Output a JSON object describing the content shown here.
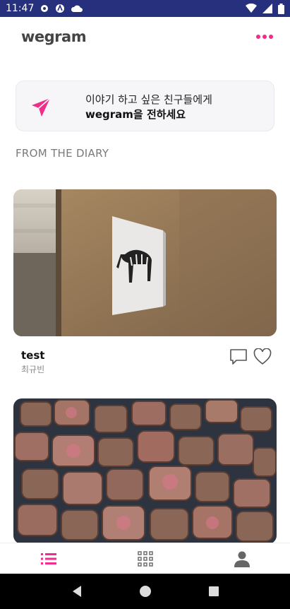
{
  "status_bar": {
    "time": "11:47",
    "icons_left": [
      "gear-icon",
      "a-icon",
      "cloud-icon"
    ],
    "icons_right": [
      "wifi-icon",
      "signal-icon",
      "battery-icon"
    ]
  },
  "app": {
    "logo": "wegram",
    "menu_icon": "more-dots-icon",
    "accent_color": "#ef2d8b"
  },
  "share_card": {
    "line1": "이야기 하고 싶은 친구들에게",
    "line2": "wegram을 전하세요",
    "icon": "paper-plane-icon"
  },
  "section_title": "FROM THE DIARY",
  "posts": [
    {
      "title": "test",
      "author": "최규빈",
      "image": "zebra-picture-on-wall"
    },
    {
      "title": "",
      "author": "",
      "image": "steak-cubes-in-pan"
    }
  ],
  "bottom_nav": {
    "items": [
      "list-icon",
      "grid-icon",
      "profile-icon"
    ],
    "active": "list-icon"
  },
  "system_nav": [
    "back-icon",
    "home-icon",
    "recents-icon"
  ]
}
